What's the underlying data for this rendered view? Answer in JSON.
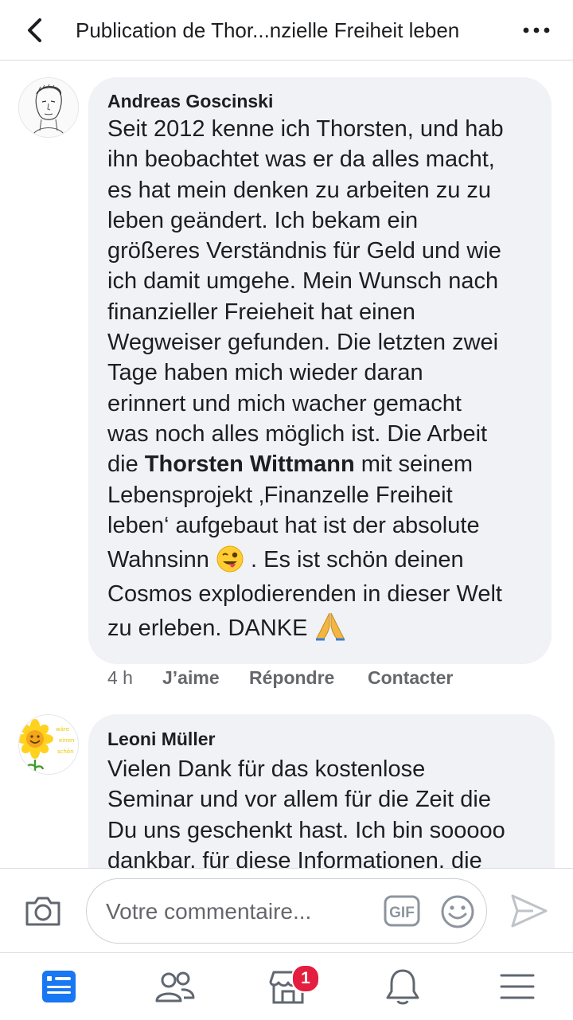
{
  "header": {
    "title": "Publication de Thor...nzielle Freiheit leben",
    "back_icon": "chevron-left-icon",
    "more_icon": "more-horizontal-icon"
  },
  "comments": [
    {
      "author": "Andreas Goscinski",
      "avatar_icon": "sketch-portrait-avatar",
      "lines": [
        "Seit 2012 kenne ich Thorsten, und hab",
        "ihn beobachtet was er da alles macht,",
        "es hat mein denken zu arbeiten zu zu",
        "leben geändert. Ich bekam ein",
        "größeres Verständnis für Geld und wie",
        "ich damit umgehe. Mein Wunsch nach",
        "finanzieller Freieheit hat einen",
        "Wegweiser gefunden. Die letzten zwei",
        "Tage haben mich wieder daran",
        "erinnert und mich wacher gemacht",
        "was noch alles möglich ist. Die Arbeit"
      ],
      "line12_pre": "die ",
      "mention": "Thorsten Wittmann",
      "line12_post": " mit seinem",
      "line13": "Lebensprojekt ‚Finanzelle Freiheit",
      "line14": "leben‘ aufgebaut hat ist der absolute",
      "line15_pre": "Wahnsinn ",
      "line15_post": " . Es ist schön deinen",
      "line16": "Cosmos explodierenden in dieser Welt",
      "line17": "zu erleben. DANKE ",
      "emoji_1": "winking-tongue-emoji-icon",
      "emoji_2": "folded-hands-emoji-icon",
      "time": "4 h",
      "like_label": "J’aime",
      "reply_label": "Répondre",
      "contact_label": "Contacter"
    },
    {
      "author": "Leoni Müller",
      "avatar_icon": "sunflower-avatar",
      "lines": [
        "Vielen Dank für das kostenlose",
        "Seminar und vor allem für die Zeit die",
        "Du uns geschenkt hast. Ich bin sooooo",
        "dankbar, für diese Informationen, die"
      ]
    }
  ],
  "composer": {
    "placeholder": "Votre commentaire...",
    "camera_icon": "camera-icon",
    "gif_label": "GIF",
    "emoji_icon": "smiley-icon",
    "send_icon": "send-icon"
  },
  "bottom_nav": {
    "items": [
      "news-feed-icon",
      "friends-icon",
      "marketplace-icon",
      "notifications-icon",
      "menu-icon"
    ],
    "marketplace_badge": "1"
  },
  "colors": {
    "accent": "#1877f2",
    "bubble_bg": "#f0f2f5",
    "secondary_text": "#65676b",
    "badge": "#e41e3f"
  }
}
